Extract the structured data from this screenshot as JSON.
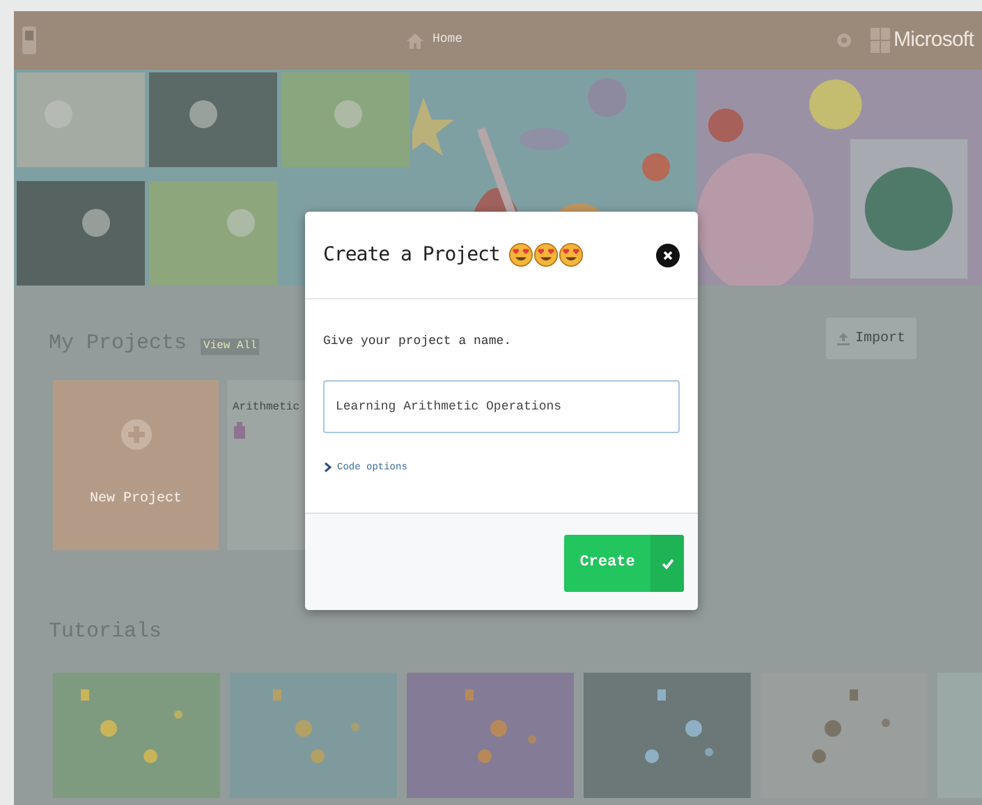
{
  "header": {
    "home": "Home",
    "brand": "Microsoft"
  },
  "my_projects": {
    "title": "My Projects",
    "view_all": "View All",
    "import": "Import",
    "new_project": "New Project",
    "projects": [
      {
        "name": "Arithmetic",
        "kind": "picture"
      }
    ]
  },
  "tutorials": {
    "title": "Tutorials"
  },
  "dialog": {
    "title": "Create a Project",
    "prompt": "Give your project a name.",
    "name_value": "Learning Arithmetic Operations",
    "code_options": {
      "label": "Code options",
      "expanded": false
    },
    "create": "Create"
  }
}
